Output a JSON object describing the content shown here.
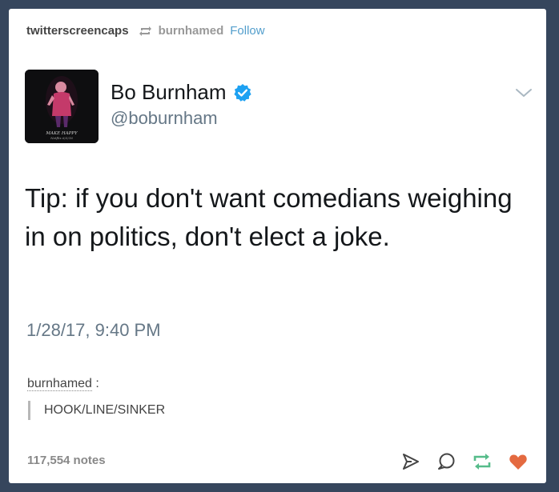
{
  "header": {
    "blog_name": "twitterscreencaps",
    "source_name": "burnhamed",
    "follow_label": "Follow",
    "reblog_icon": "reblog-icon"
  },
  "tweet": {
    "name": "Bo Burnham",
    "handle": "@boburnham",
    "text": "Tip: if you don't want comedians weighing in on politics, don't elect a joke.",
    "timestamp": "1/28/17, 9:40 PM",
    "avatar_caption_line1": "MAKE HAPPY",
    "avatar_caption_line2": "Netflix 6/3/16",
    "verified_icon": "verified-badge-icon",
    "menu_icon": "chevron-down-icon",
    "verified_color": "#1da1f2"
  },
  "comment": {
    "user": "burnhamed",
    "separator": ":",
    "text": "HOOK/LINE/SINKER"
  },
  "footer": {
    "notes": "117,554 notes",
    "icons": [
      "share-icon",
      "reply-icon",
      "reblog-icon",
      "like-icon"
    ],
    "reblog_color": "#56bc8a",
    "like_color": "#e46a40"
  },
  "colors": {
    "background": "#36465d",
    "card": "#ffffff",
    "link": "#529ecc"
  }
}
